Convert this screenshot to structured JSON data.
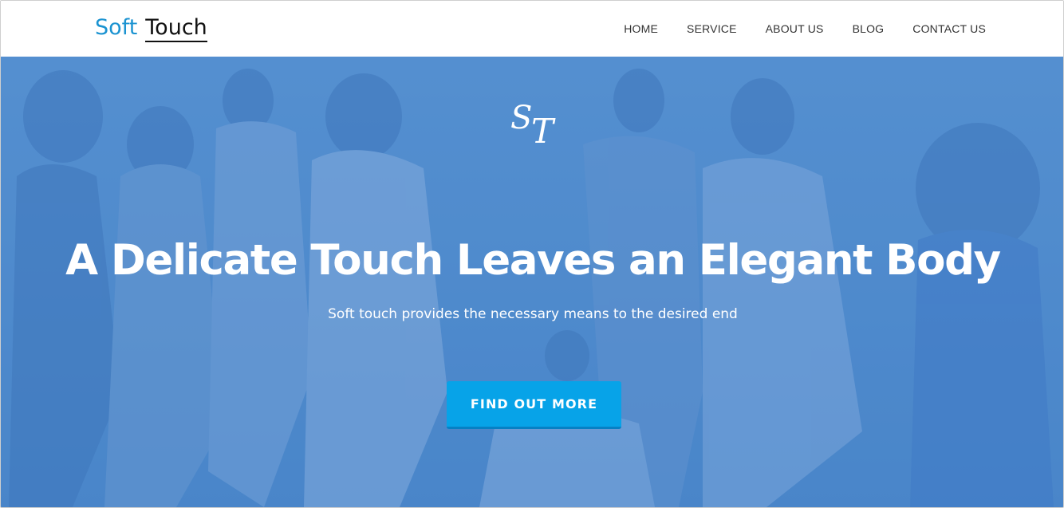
{
  "brand": {
    "part1": "Soft",
    "part2": "Touch"
  },
  "nav": {
    "items": [
      {
        "label": "HOME"
      },
      {
        "label": "SERVICE"
      },
      {
        "label": "ABOUT US"
      },
      {
        "label": "BLOG"
      },
      {
        "label": "CONTACT US"
      }
    ]
  },
  "hero": {
    "monogram": {
      "s": "S",
      "t": "T"
    },
    "title": "A Delicate Touch Leaves an Elegant Body",
    "subtitle": "Soft touch provides the necessary means to the desired end",
    "cta_label": "FIND OUT MORE",
    "overlay_color": "#4884ce"
  },
  "colors": {
    "brand_blue": "#1b93d1",
    "cta_blue": "#07a3e8",
    "nav_text": "#333333"
  }
}
